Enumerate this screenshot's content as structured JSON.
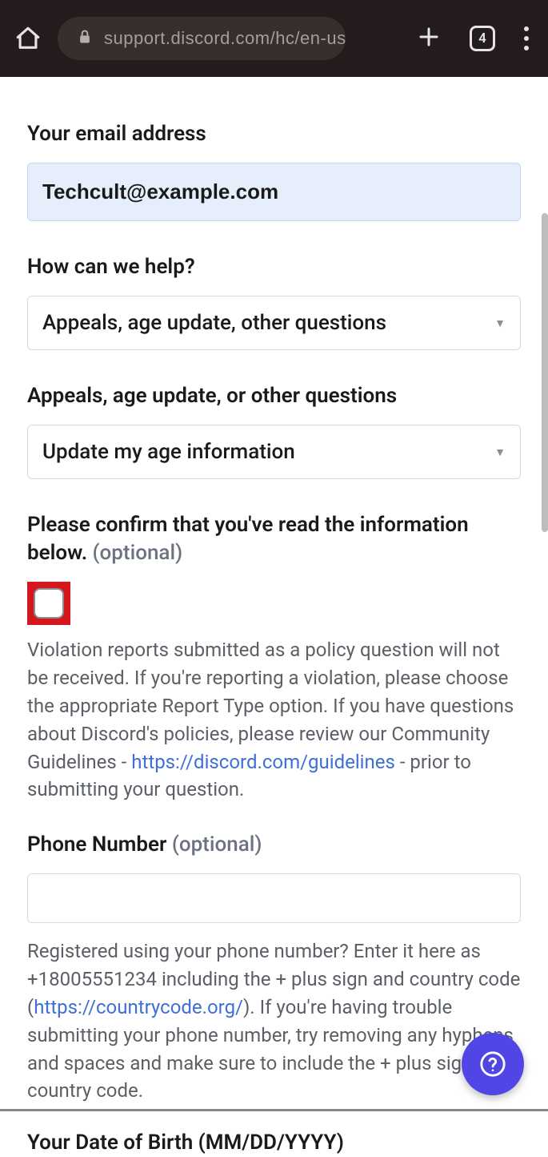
{
  "chrome": {
    "url": "support.discord.com/hc/en-us/requ",
    "tab_count": "4"
  },
  "form": {
    "email_label": "Your email address",
    "email_value": "Techcult@example.com",
    "help_label": "How can we help?",
    "help_value": "Appeals, age update, other questions",
    "sub_label": "Appeals, age update, or other questions",
    "sub_value": "Update my age information",
    "confirm_label_a": "Please confirm that you've read the information below.",
    "confirm_optional": " (optional)",
    "confirm_hint_a": "Violation reports submitted as a policy question will not be received. If you're reporting a violation, please choose the appropriate Report Type option. If you have questions about Discord's policies, please review our Community Guidelines - ",
    "confirm_link": "https://discord.com/guidelines",
    "confirm_hint_b": " - prior to submitting your question.",
    "phone_label": "Phone Number",
    "phone_optional": " (optional)",
    "phone_hint_a": "Registered using your phone number? Enter it here as +18005551234 including the + plus sign and country code (",
    "phone_link": "https://countrycode.org/",
    "phone_hint_b": "). If you're having trouble submitting your phone number, try removing any hyphens and spaces and make sure to include the + plus sign and country code.",
    "dob_label": "Your Date of Birth (MM/DD/YYYY)"
  }
}
